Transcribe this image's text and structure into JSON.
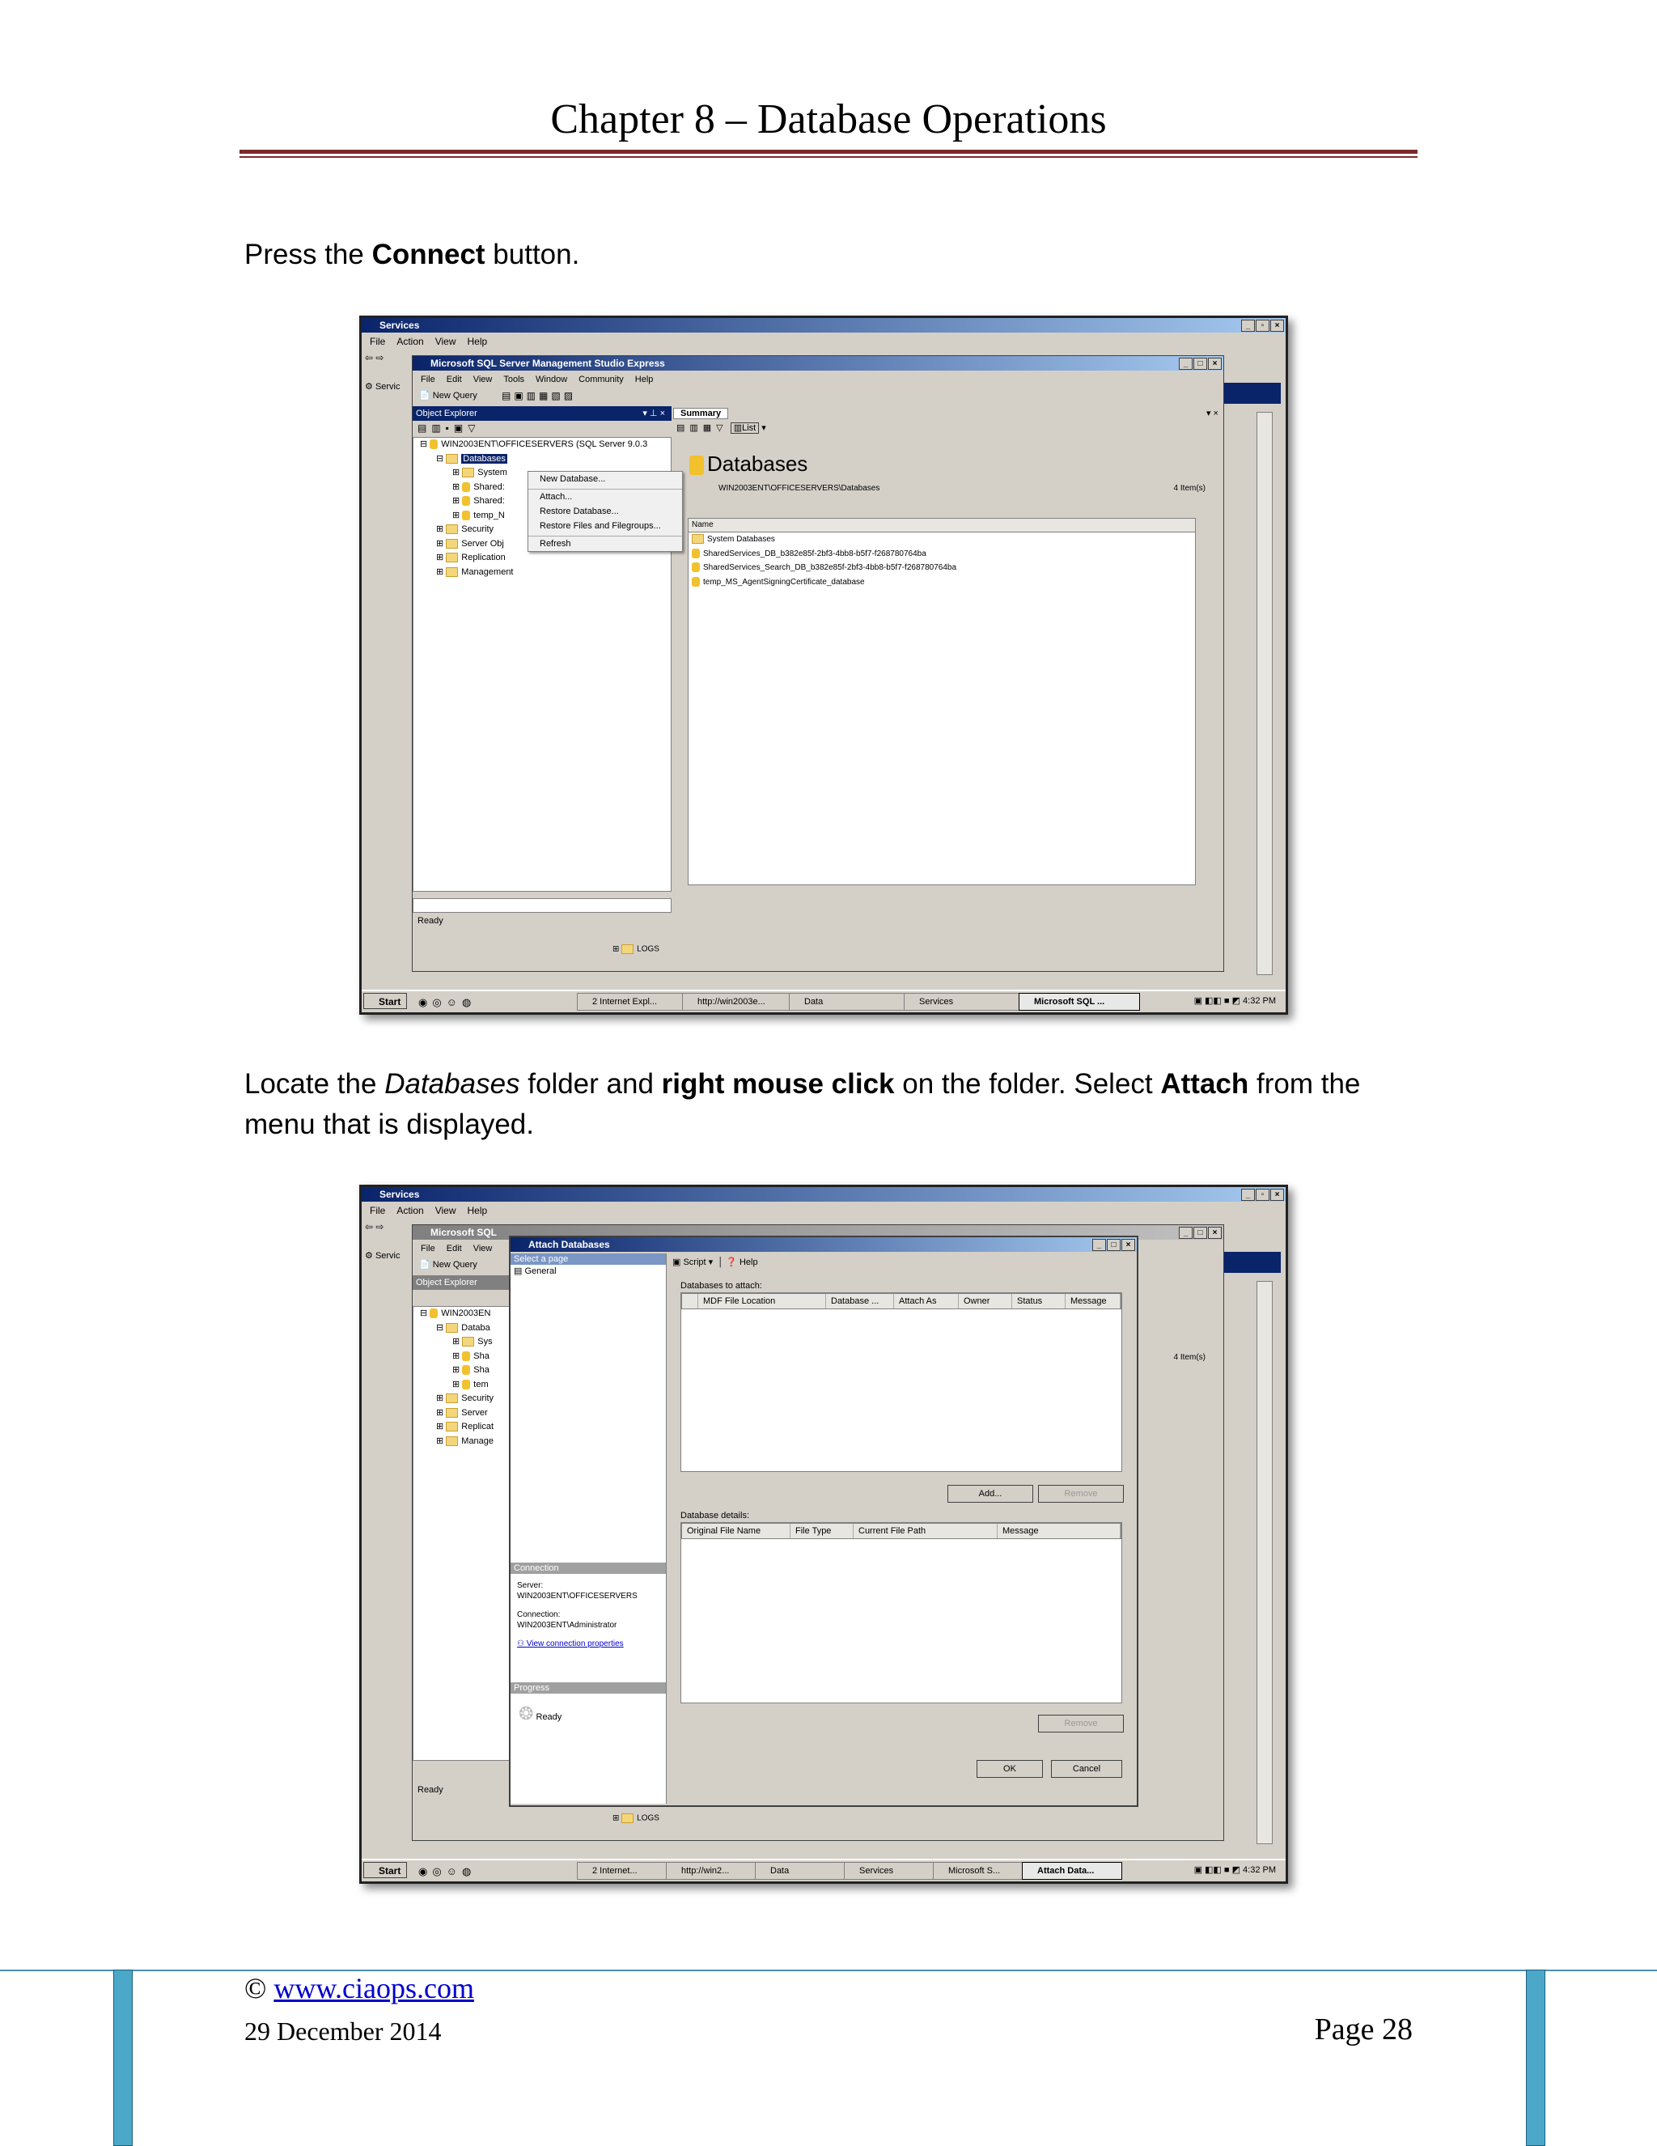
{
  "header": {
    "title": "Chapter 8 – Database Operations"
  },
  "para1": {
    "prefix": "Press the ",
    "bold": "Connect",
    "suffix": " button."
  },
  "para2": {
    "p1": "Locate the ",
    "italic": "Databases",
    "p2": " folder and ",
    "bold1": "right mouse click",
    "p3": " on the folder. Select ",
    "bold2": "Attach",
    "p4": " from the menu that is displayed."
  },
  "shot1": {
    "services_title": "Services",
    "services_menu": [
      "File",
      "Action",
      "View",
      "Help"
    ],
    "ssms_title": "Microsoft SQL Server Management Studio Express",
    "ssms_menu": [
      "File",
      "Edit",
      "View",
      "Tools",
      "Window",
      "Community",
      "Help"
    ],
    "new_query": "New Query",
    "object_explorer": "Object Explorer",
    "tree_root": "WIN2003ENT\\OFFICESERVERS (SQL Server 9.0.3",
    "tree_databases": "Databases",
    "tree_children": [
      "System",
      "Shared:",
      "Shared:",
      "temp_N"
    ],
    "tree_other": [
      "Security",
      "Server Obj",
      "Replication",
      "Management"
    ],
    "context_menu": [
      "New Database...",
      "Attach...",
      "Restore Database...",
      "Restore Files and Filegroups...",
      "Refresh"
    ],
    "summary_tab": "Summary",
    "list_label": "List",
    "summary_heading": "Databases",
    "summary_path": "WIN2003ENT\\OFFICESERVERS\\Databases",
    "item_count": "4 Item(s)",
    "list_header": "Name",
    "list_items": [
      "System Databases",
      "SharedServices_DB_b382e85f-2bf3-4bb8-b5f7-f268780764ba",
      "SharedServices_Search_DB_b382e85f-2bf3-4bb8-b5f7-f268780764ba",
      "temp_MS_AgentSigningCertificate_database"
    ],
    "status": "Ready",
    "logs": "LOGS",
    "start": "Start",
    "tasks": [
      "2 Internet Expl...",
      "http://win2003e...",
      "Data",
      "Services",
      "Microsoft SQL ..."
    ],
    "clock": "4:32 PM",
    "services_tab": "Servic"
  },
  "shot2": {
    "services_title": "Services",
    "services_menu": [
      "File",
      "Action",
      "View",
      "Help"
    ],
    "ssms_title_partial": "Microsoft SQL",
    "ssms_menu_partial": [
      "File",
      "Edit",
      "View"
    ],
    "new_query": "New Query",
    "object_explorer": "Object Explorer",
    "tree_root": "WIN2003EN",
    "tree_items": [
      "Databa",
      "Sys",
      "Sha",
      "Sha",
      "tem",
      "Security",
      "Server",
      "Replicat",
      "Manage"
    ],
    "dialog_title": "Attach Databases",
    "select_page": "Select a page",
    "page_general": "General",
    "script": "Script",
    "help": "Help",
    "databases_to_attach": "Databases to attach:",
    "grid1_cols": [
      "MDF File Location",
      "Database ...",
      "Attach As",
      "Owner",
      "Status",
      "Message"
    ],
    "add_button": "Add...",
    "remove_button": "Remove",
    "database_details": "Database details:",
    "grid2_cols": [
      "Original File Name",
      "File Type",
      "Current File Path",
      "Message"
    ],
    "connection_header": "Connection",
    "server_label": "Server:",
    "server_value": "WIN2003ENT\\OFFICESERVERS",
    "connection_label": "Connection:",
    "connection_value": "WIN2003ENT\\Administrator",
    "view_connection": "View connection properties",
    "progress_header": "Progress",
    "progress_status": "Ready",
    "remove_button2": "Remove",
    "ok_button": "OK",
    "cancel_button": "Cancel",
    "item_count": "4 Item(s)",
    "status": "Ready",
    "logs": "LOGS",
    "start": "Start",
    "tasks": [
      "2 Internet...",
      "http://win2...",
      "Data",
      "Services",
      "Microsoft S...",
      "Attach Data..."
    ],
    "clock": "4:32 PM",
    "services_tab": "Servic"
  },
  "footer": {
    "copyright": "©",
    "link": "www.ciaops.com",
    "date": "29 December 2014",
    "page": "Page 28"
  }
}
